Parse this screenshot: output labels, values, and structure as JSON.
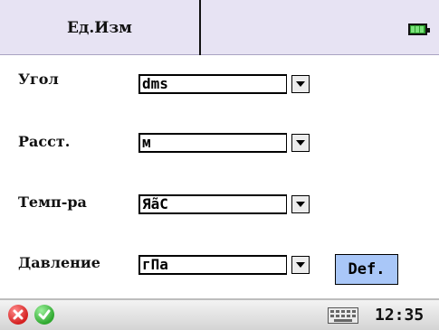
{
  "header": {
    "tab_label": "Ед.Изм",
    "battery_icon": "battery-full-icon"
  },
  "form": {
    "rows": [
      {
        "label": "Угол",
        "value": "dms"
      },
      {
        "label": "Расст.",
        "value": "м"
      },
      {
        "label": "Темп-ра",
        "value": "ЯãС"
      },
      {
        "label": "Давление",
        "value": "гПа"
      }
    ],
    "dropdown_icon": "triangle-down-icon",
    "default_button": "Def."
  },
  "taskbar": {
    "cancel_icon": "cancel-icon",
    "ok_icon": "ok-icon",
    "keyboard_icon": "keyboard-icon",
    "time": "12:35"
  },
  "colors": {
    "header_bg": "#e7e3f3",
    "def_button_bg": "#a9c7f8",
    "cancel_red": "#e23b3b",
    "ok_green": "#3fc33f"
  }
}
